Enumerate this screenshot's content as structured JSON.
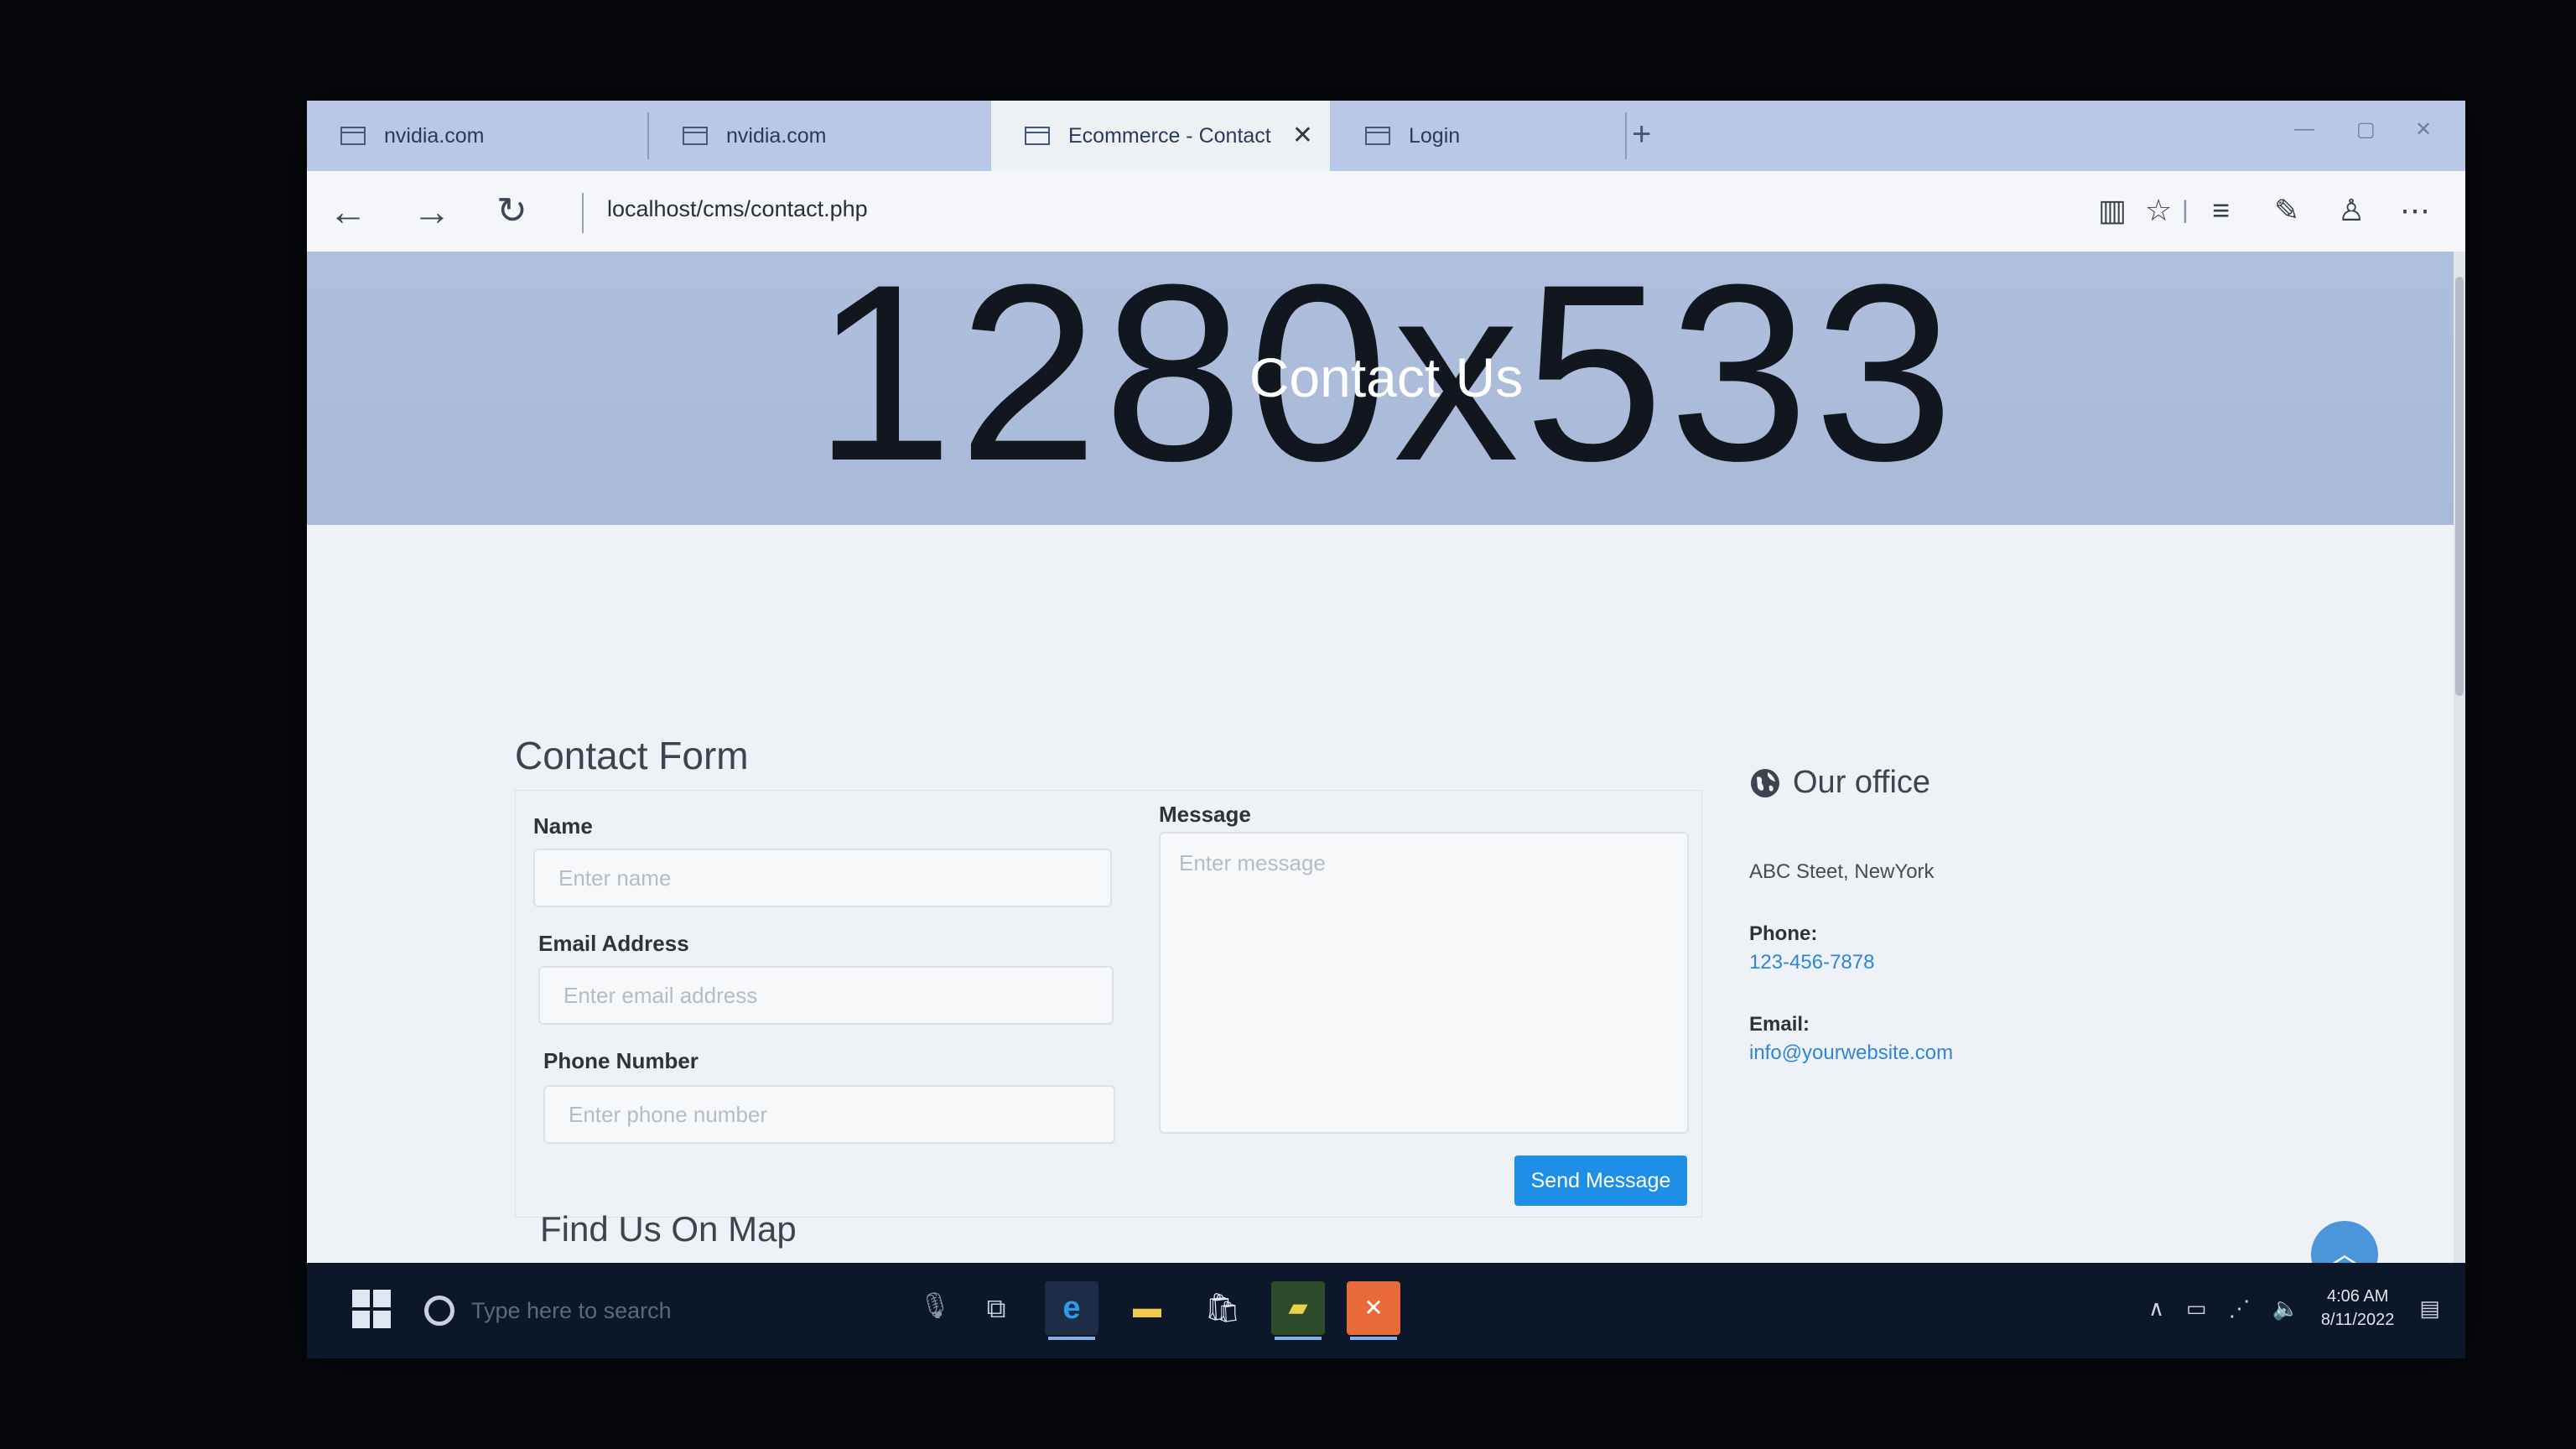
{
  "browser": {
    "tabs": [
      {
        "label": "nvidia.com",
        "active": false
      },
      {
        "label": "nvidia.com",
        "active": false
      },
      {
        "label": "Ecommerce - Contact",
        "active": true
      },
      {
        "label": "Login",
        "active": false
      }
    ],
    "new_tab_icon": "plus-icon",
    "nav_icons": [
      "back-arrow-icon",
      "forward-arrow-icon",
      "refresh-icon"
    ],
    "address": "localhost/cms/contact.php",
    "toolbar_icons": [
      "reading-view-icon",
      "favorite-star-icon",
      "hub-icon",
      "web-note-icon",
      "share-icon",
      "more-icon"
    ]
  },
  "hero": {
    "placeholder_text": "1280x533",
    "title": "Contact Us"
  },
  "contact_form": {
    "heading": "Contact Form",
    "name_label": "Name",
    "name_placeholder": "Enter name",
    "email_label": "Email Address",
    "email_placeholder": "Enter email address",
    "phone_label": "Phone Number",
    "phone_placeholder": "Enter phone number",
    "message_label": "Message",
    "message_placeholder": "Enter message",
    "submit_label": "Send Message"
  },
  "office": {
    "heading": "Our office",
    "icon": "globe-icon",
    "address": "ABC Steet, NewYork",
    "phone_label": "Phone:",
    "phone": "123-456-7878",
    "email_label": "Email:",
    "email": "info@yourwebsite.com"
  },
  "map": {
    "heading": "Find Us On Map"
  },
  "scroll_top_icon": "chevron-up-icon",
  "taskbar": {
    "search_placeholder": "Type here to search",
    "clock_time": "4:06 AM",
    "clock_date": "8/11/2022"
  },
  "colors": {
    "accent": "#1d8fe6",
    "link": "#2f86d6",
    "hero_bg": "#aebfdd",
    "tabstrip_bg": "#b9c8e6",
    "taskbar_bg": "#0c1829"
  }
}
